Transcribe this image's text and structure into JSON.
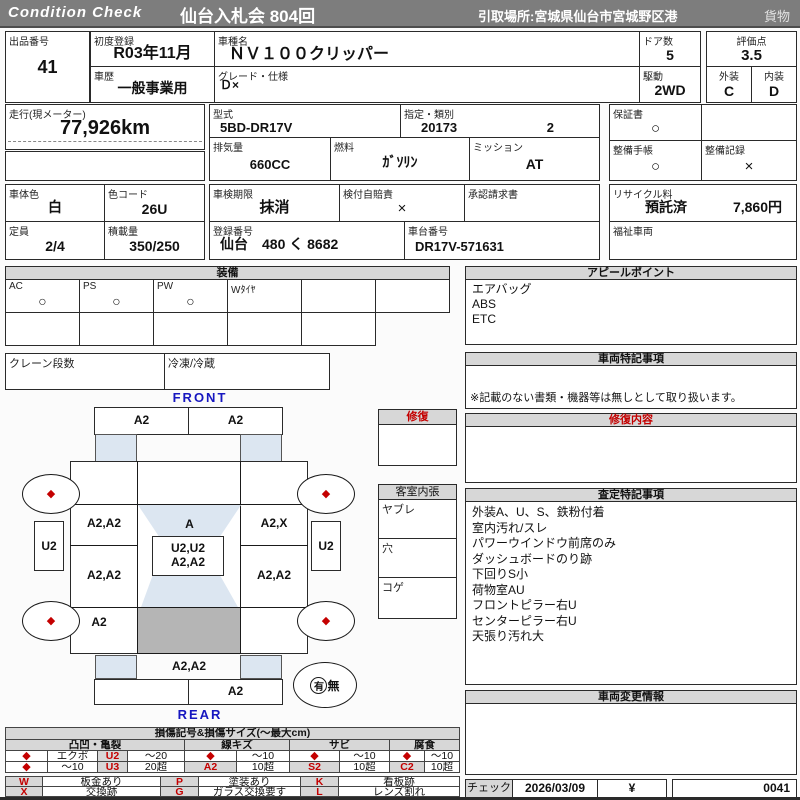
{
  "header": {
    "brand": "Condition  Check",
    "auction": "仙台入札会  804回",
    "pickup": "引取場所:宮城県仙台市宮城野区港",
    "category": "貨物"
  },
  "fields": {
    "lot": {
      "label": "出品番号",
      "value": "41"
    },
    "first_reg": {
      "label": "初度登録",
      "value": "R03年11月"
    },
    "history": {
      "label": "車歴",
      "value": "一般事業用"
    },
    "model_name": {
      "label": "車種名",
      "value": "ＮＶ１００クリッパー"
    },
    "grade": {
      "label": "グレード・仕様",
      "value": "Ｄ×"
    },
    "doors": {
      "label": "ドア数",
      "value": "5"
    },
    "score": {
      "label": "評価点",
      "value": "3.5"
    },
    "drive": {
      "label": "駆動",
      "value": "2WD"
    },
    "exterior": {
      "label": "外装",
      "value": "C"
    },
    "interior": {
      "label": "内装",
      "value": "D"
    },
    "mileage": {
      "label": "走行(現メーター)",
      "value": "77,926km"
    },
    "model_code": {
      "label": "型式",
      "value": "5BD-DR17V"
    },
    "designation": {
      "label": "指定・類別",
      "value": "20173",
      "value2": "2"
    },
    "displacement": {
      "label": "排気量",
      "value": "660CC"
    },
    "fuel": {
      "label": "燃料",
      "value": "ｶﾞｿﾘﾝ"
    },
    "mission": {
      "label": "ミッション",
      "value": "AT"
    },
    "warranty": {
      "label": "保証書",
      "value": "○"
    },
    "maintenance_book": {
      "label": "整備手帳",
      "value": "○"
    },
    "maintenance_record": {
      "label": "整備記録",
      "value": "×"
    },
    "body_color": {
      "label": "車体色",
      "value": "白"
    },
    "color_code": {
      "label": "色コード",
      "value": "26U"
    },
    "inspection": {
      "label": "車検期限",
      "value": "抹消"
    },
    "insurance": {
      "label": "検付自賠責",
      "value": "×"
    },
    "approval": {
      "label": "承認請求書",
      "value": ""
    },
    "recycle": {
      "label": "リサイクル料",
      "status": "預託済",
      "amount": "7,860円"
    },
    "capacity": {
      "label": "定員",
      "value": "2/4"
    },
    "load": {
      "label": "積載量",
      "value": "350/250"
    },
    "reg_number": {
      "label": "登録番号",
      "value": "仙台　480 く  8682"
    },
    "chassis": {
      "label": "車台番号",
      "value": "DR17V-571631"
    },
    "welfare": {
      "label": "福祉車両",
      "value": ""
    }
  },
  "equipment": {
    "title": "装備",
    "items": [
      {
        "label": "AC",
        "value": "○"
      },
      {
        "label": "PS",
        "value": "○"
      },
      {
        "label": "PW",
        "value": "○"
      },
      {
        "label": "Wﾀｲﾔ",
        "value": ""
      },
      {
        "label": "",
        "value": ""
      },
      {
        "label": "",
        "value": ""
      }
    ],
    "crane": {
      "label": "クレーン段数",
      "value": ""
    },
    "fridge": {
      "label": "冷凍/冷蔵",
      "value": ""
    }
  },
  "appeal": {
    "title": "アピールポイント",
    "items": [
      "エアバッグ",
      "ABS",
      "ETC"
    ]
  },
  "vehicle_notes": {
    "title": "車両特記事項",
    "note": "※記載のない書類・機器等は無しとして取り扱います。"
  },
  "repair_info": {
    "title": "修復内容",
    "content": ""
  },
  "assessment": {
    "title": "査定特記事項",
    "items": [
      "外装A、U、S、鉄粉付着",
      "室内汚れ/スレ",
      "パワーウインドウ前席のみ",
      "ダッシュボードのり跡",
      "下回りS小",
      "荷物室AU",
      "フロントピラー右U",
      "センターピラー右U",
      "天張り汚れ大"
    ]
  },
  "change_info": {
    "title": "車両変更情報",
    "content": ""
  },
  "check": {
    "label": "チェック",
    "date": "2026/03/09",
    "mark": "¥",
    "number": "0041"
  },
  "diagram": {
    "front_label": "FRONT",
    "rear_label": "REAR",
    "wheel_mark": "◆",
    "marks": {
      "front_bumper_left": "A2",
      "front_bumper_right": "A2",
      "hood_left": "A2,A2",
      "windshield": "A",
      "hood_right": "A2,X",
      "mirror_left": "U2",
      "mirror_right": "U2",
      "roof_line1": "U2,U2",
      "roof_line2": "A2,A2",
      "side_left": "A2,A2",
      "side_right": "A2,A2",
      "rocker_left": "A2",
      "rear_gate": "A2,A2",
      "rear_bumper_right": "A2"
    },
    "spare": {
      "has": "有",
      "no": "無"
    },
    "repair_box_title": "修復",
    "cabin": {
      "title": "客室内張",
      "items": [
        "ヤブレ",
        "穴",
        "コゲ"
      ]
    }
  },
  "legend": {
    "title": "損傷記号&損傷サイズ(～最大cm)",
    "groups": [
      {
        "name": "凸凹・亀裂",
        "row1": [
          "◆",
          "エクボ",
          "U2",
          "～20"
        ],
        "row2": [
          "◆",
          "～10",
          "U3",
          "20超"
        ]
      },
      {
        "name": "線キズ",
        "row1": [
          "◆",
          "～10"
        ],
        "row2": [
          "A2",
          "10超"
        ]
      },
      {
        "name": "サビ",
        "row1": [
          "◆",
          "～10"
        ],
        "row2": [
          "S2",
          "10超"
        ]
      },
      {
        "name": "腐食",
        "row1": [
          "◆",
          "～10"
        ],
        "row2": [
          "C2",
          "10超"
        ]
      }
    ],
    "codes": {
      "w": {
        "code": "W",
        "desc": "板金あり"
      },
      "x": {
        "code": "X",
        "desc": "交換跡"
      },
      "p": {
        "code": "P",
        "desc": "塗装あり"
      },
      "g": {
        "code": "G",
        "desc": "ガラス交換要す"
      },
      "k": {
        "code": "K",
        "desc": "看板跡"
      },
      "l": {
        "code": "L",
        "desc": "レンズ割れ"
      }
    }
  }
}
